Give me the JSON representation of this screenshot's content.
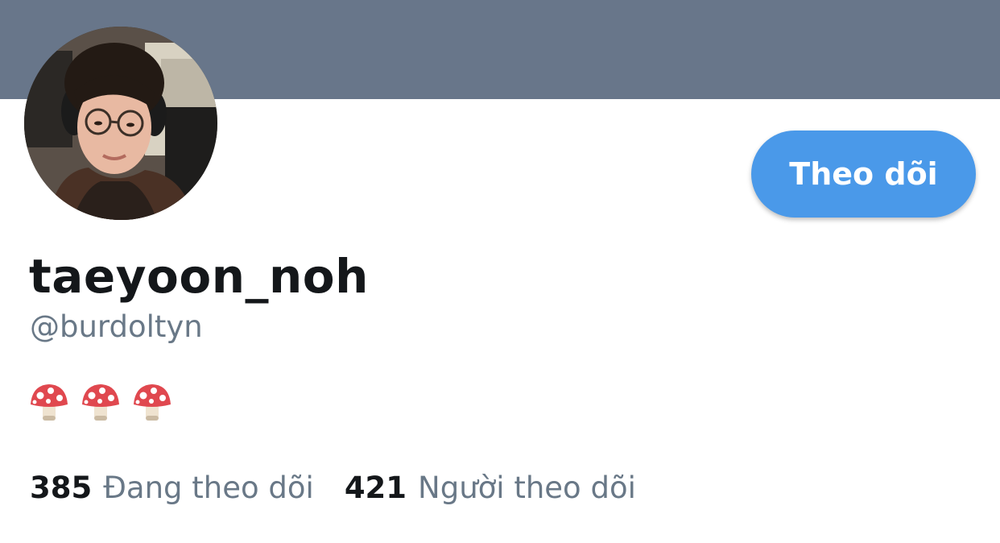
{
  "profile": {
    "display_name": "taeyoon_noh",
    "handle": "@burdoltyn",
    "bio_icons": [
      "mushroom-icon",
      "mushroom-icon",
      "mushroom-icon"
    ],
    "follow_label": "Theo dõi"
  },
  "stats": {
    "following_count": "385",
    "following_label": "Đang theo dõi",
    "followers_count": "421",
    "followers_label": "Người theo dõi"
  },
  "colors": {
    "banner": "#68768a",
    "follow_button": "#4a99e9",
    "primary_text": "#14171a",
    "secondary_text": "#697887"
  }
}
